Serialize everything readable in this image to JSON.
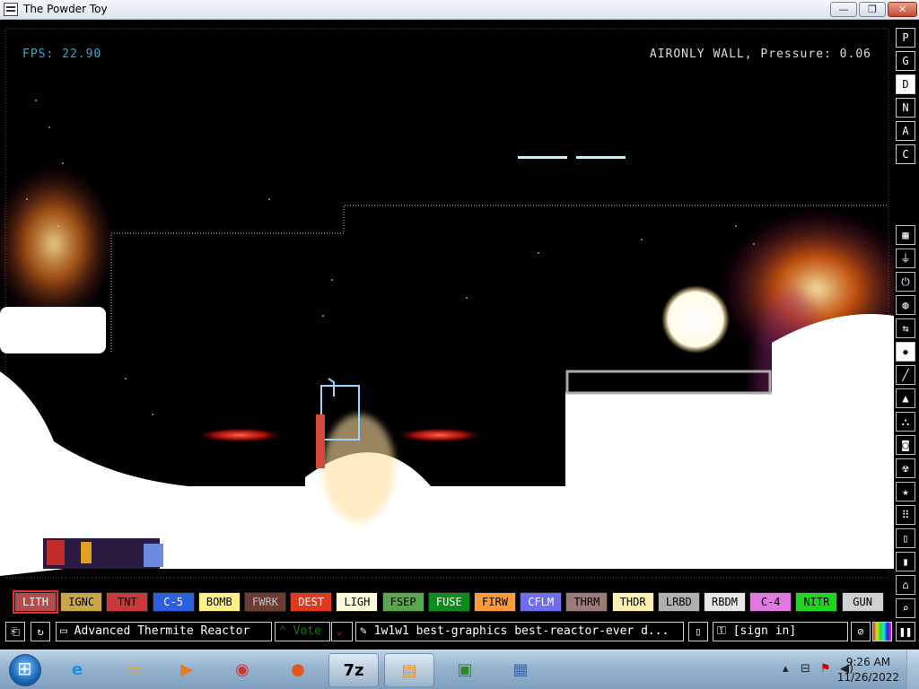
{
  "window": {
    "title": "The Powder Toy",
    "min": "—",
    "max": "❐",
    "close": "✕"
  },
  "hud": {
    "fps": "FPS: 22.90",
    "status": "AIRONLY WALL, Pressure: 0.06"
  },
  "sidebar": {
    "menu": [
      "P",
      "G",
      "D",
      "N",
      "A",
      "C"
    ],
    "selected_menu": "D",
    "categories": [
      {
        "icon": "walls-icon",
        "glyph": "▦"
      },
      {
        "icon": "electronics-icon",
        "glyph": "⏚"
      },
      {
        "icon": "power-icon",
        "glyph": "⏻"
      },
      {
        "icon": "sensor-icon",
        "glyph": "◍"
      },
      {
        "icon": "force-icon",
        "glyph": "⇆"
      },
      {
        "icon": "explosives-icon",
        "glyph": "✸"
      },
      {
        "icon": "gases-icon",
        "glyph": "╱"
      },
      {
        "icon": "liquids-icon",
        "glyph": "▲"
      },
      {
        "icon": "powders-icon",
        "glyph": "⛬"
      },
      {
        "icon": "solids-icon",
        "glyph": "◙"
      },
      {
        "icon": "radioactive-icon",
        "glyph": "☢"
      },
      {
        "icon": "special-icon",
        "glyph": "★"
      },
      {
        "icon": "life-icon",
        "glyph": "⠿"
      },
      {
        "icon": "tools-icon",
        "glyph": "▯"
      },
      {
        "icon": "favorites-icon",
        "glyph": "▮"
      },
      {
        "icon": "recent-icon",
        "glyph": "⌂"
      },
      {
        "icon": "search-icon",
        "glyph": "⌕"
      }
    ],
    "selected_category": "explosives-icon"
  },
  "palette": [
    {
      "label": "LITH",
      "bg": "#b34b4b",
      "fg": "#ffffff"
    },
    {
      "label": "IGNC",
      "bg": "#c9a64a",
      "fg": "#000000"
    },
    {
      "label": "TNT",
      "bg": "#c83a3a",
      "fg": "#000000"
    },
    {
      "label": "C-5",
      "bg": "#2b5fe0",
      "fg": "#ffffff"
    },
    {
      "label": "BOMB",
      "bg": "#fff08a",
      "fg": "#000000"
    },
    {
      "label": "FWRK",
      "bg": "#6d3b32",
      "fg": "#c0c0c0"
    },
    {
      "label": "DEST",
      "bg": "#e03a1e",
      "fg": "#ffffff"
    },
    {
      "label": "LIGH",
      "bg": "#fffdd6",
      "fg": "#000000"
    },
    {
      "label": "FSEP",
      "bg": "#5aa84a",
      "fg": "#000000"
    },
    {
      "label": "FUSE",
      "bg": "#0e8a1a",
      "fg": "#ffffff"
    },
    {
      "label": "FIRW",
      "bg": "#ff9a3a",
      "fg": "#000000"
    },
    {
      "label": "CFLM",
      "bg": "#6e6eee",
      "fg": "#ffffff"
    },
    {
      "label": "THRM",
      "bg": "#9c7a7a",
      "fg": "#000000"
    },
    {
      "label": "THDR",
      "bg": "#fff2b0",
      "fg": "#000000"
    },
    {
      "label": "LRBD",
      "bg": "#b0b0b0",
      "fg": "#000000"
    },
    {
      "label": "RBDM",
      "bg": "#e6e6e6",
      "fg": "#000000"
    },
    {
      "label": "C-4",
      "bg": "#e07ae0",
      "fg": "#000000"
    },
    {
      "label": "NITR",
      "bg": "#1ed61e",
      "fg": "#000000"
    },
    {
      "label": "GUN",
      "bg": "#d0d0d0",
      "fg": "#000000"
    }
  ],
  "selected_element": "LITH",
  "bottombar": {
    "open_icon": "⎗",
    "reload_icon": "↻",
    "save_name": "Advanced Thermite Reactor",
    "vote_label": "Vote",
    "tags": "1w1w1 best-graphics best-reactor-ever d...",
    "sign_in": "[sign in]"
  },
  "taskbar": {
    "apps": [
      {
        "name": "internet-explorer-icon",
        "glyph": "e",
        "color": "#1e8fe0"
      },
      {
        "name": "file-explorer-icon",
        "glyph": "▭",
        "color": "#d9a93a"
      },
      {
        "name": "media-player-icon",
        "glyph": "▶",
        "color": "#e67a1e"
      },
      {
        "name": "chrome-icon",
        "glyph": "◉",
        "color": "#d93025"
      },
      {
        "name": "firefox-icon",
        "glyph": "●",
        "color": "#e8541e"
      },
      {
        "name": "7zip-icon",
        "glyph": "7z",
        "color": "#000000"
      },
      {
        "name": "powder-toy-icon",
        "glyph": "▤",
        "color": "#e8901e"
      },
      {
        "name": "computer-icon",
        "glyph": "▣",
        "color": "#2a8a2a"
      },
      {
        "name": "network-icon",
        "glyph": "▦",
        "color": "#3a6ab0"
      }
    ],
    "time": "9:26 AM",
    "date": "11/26/2022"
  }
}
